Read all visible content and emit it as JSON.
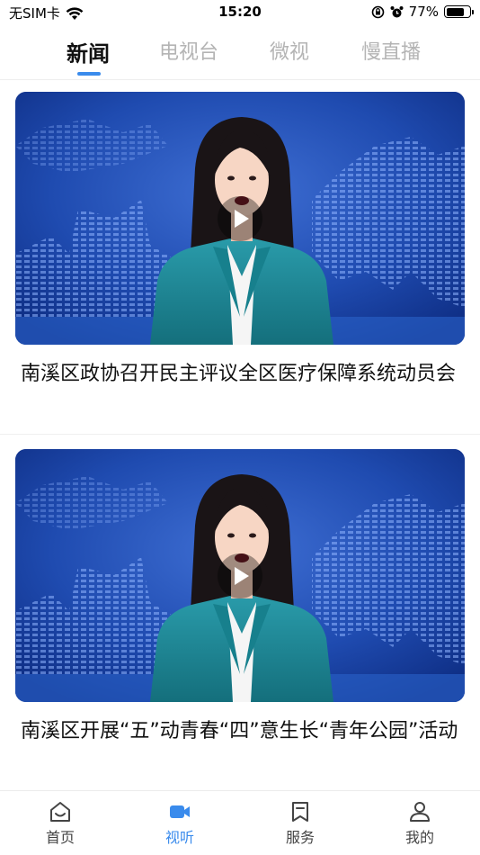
{
  "status_bar": {
    "carrier": "无SIM卡",
    "time": "15:20",
    "battery": "77%",
    "battery_level": 0.77
  },
  "tabs": [
    {
      "label": "新闻",
      "active": true
    },
    {
      "label": "电视台",
      "active": false
    },
    {
      "label": "微视",
      "active": false
    },
    {
      "label": "慢直播",
      "active": false
    }
  ],
  "news": [
    {
      "title": "南溪区政协召开民主评议全区医疗保障系统动员会"
    },
    {
      "title": "南溪区开展“五”动青春“四”意生长“青年公园”活动"
    }
  ],
  "bottom_nav": [
    {
      "label": "首页",
      "icon": "home-icon",
      "active": false
    },
    {
      "label": "视听",
      "icon": "video-camera-icon",
      "active": true
    },
    {
      "label": "服务",
      "icon": "bookmark-icon",
      "active": false
    },
    {
      "label": "我的",
      "icon": "user-icon",
      "active": false
    }
  ],
  "colors": {
    "accent": "#3a8bec",
    "inactive_tab": "#b4b4b4",
    "studio_bg": "#1b3d9a",
    "anchor_suit": "#1e8a9a"
  }
}
